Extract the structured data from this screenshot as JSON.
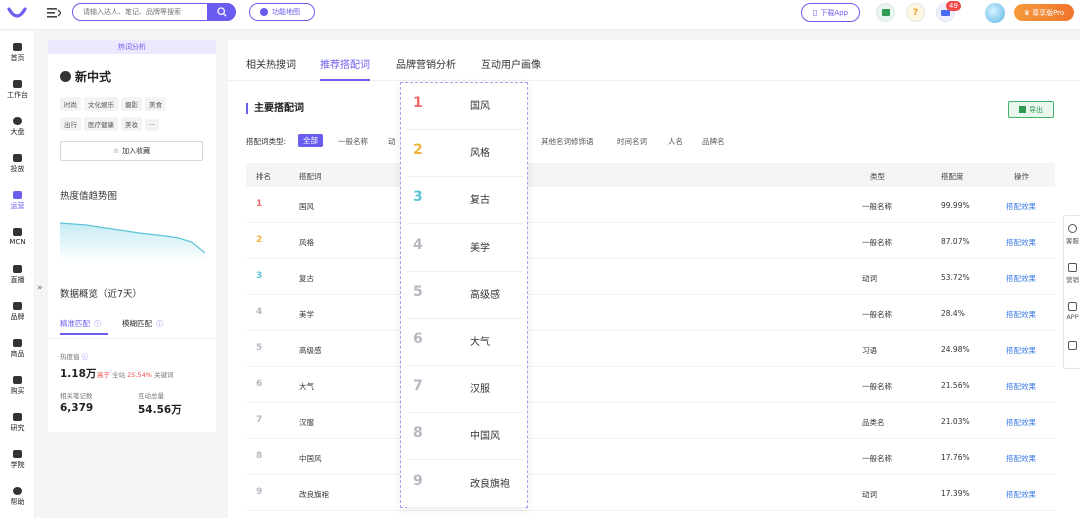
{
  "topbar": {
    "search_placeholder": "请输入达人、笔记、品牌等搜索",
    "feature_map_label": "功能地图",
    "download_app_label": "下载App",
    "notification_count": "49",
    "pro_label": "尊享版Pro"
  },
  "leftnav": {
    "items": [
      {
        "label": "首页",
        "icon": "home-icon"
      },
      {
        "label": "工作台",
        "icon": "workbench-icon"
      },
      {
        "label": "大盘",
        "icon": "pie-icon"
      },
      {
        "label": "投放",
        "icon": "folder-icon"
      },
      {
        "label": "运营",
        "icon": "chart-icon"
      },
      {
        "label": "MCN",
        "icon": "mcn-icon"
      },
      {
        "label": "直播",
        "icon": "video-icon"
      },
      {
        "label": "品牌",
        "icon": "bag-icon"
      },
      {
        "label": "商品",
        "icon": "shop-icon"
      },
      {
        "label": "购买",
        "icon": "cart-icon"
      },
      {
        "label": "研究",
        "icon": "research-icon"
      },
      {
        "label": "学院",
        "icon": "academy-icon"
      },
      {
        "label": "帮助",
        "icon": "help-icon"
      }
    ],
    "active_index": 4
  },
  "leftpanel": {
    "hot_tag": "热词分析",
    "keyword": "新中式",
    "tags": [
      "时尚",
      "文化娱乐",
      "摄影",
      "美食",
      "出行",
      "医疗健康",
      "美妆",
      "···"
    ],
    "fav_label": "加入收藏",
    "trend_title": "热度值趋势图",
    "trend_values": [
      0.78,
      0.76,
      0.74,
      0.7,
      0.66,
      0.62,
      0.58,
      0.55,
      0.52,
      0.48,
      0.4,
      0.18
    ],
    "overview_title": "数据概览（近7天）",
    "match_tabs": [
      "精准匹配",
      "模糊匹配"
    ],
    "metrics": {
      "heat_label": "热度值",
      "heat_value": "1.18万",
      "heat_note_prefix": "高于",
      "heat_note_mid": "全站",
      "heat_note_pct": "25.54%",
      "heat_note_suffix": "关键词",
      "notes_label": "相关笔记数",
      "notes_value": "6,379",
      "interact_label": "互动总量",
      "interact_value": "54.56万"
    }
  },
  "main": {
    "tabs": [
      "相关热搜词",
      "推荐搭配词",
      "品牌营销分析",
      "互动用户画像"
    ],
    "active_tab": 1,
    "section_title": "主要搭配词",
    "export_label": "导出",
    "filter_label": "搭配词类型:",
    "filters": [
      "全部",
      "一般名称",
      "动",
      "其他名词修饰语",
      "时间名词",
      "人名",
      "品牌名"
    ],
    "columns": [
      "排名",
      "搭配词",
      "类型",
      "搭配度",
      "操作"
    ],
    "rows": [
      {
        "rank": "1",
        "word": "国风",
        "type": "一般名称",
        "score": "99.99%",
        "action": "搭配效果"
      },
      {
        "rank": "2",
        "word": "风格",
        "type": "一般名称",
        "score": "87.07%",
        "action": "搭配效果"
      },
      {
        "rank": "3",
        "word": "复古",
        "type": "动词",
        "score": "53.72%",
        "action": "搭配效果"
      },
      {
        "rank": "4",
        "word": "美学",
        "type": "一般名称",
        "score": "28.4%",
        "action": "搭配效果"
      },
      {
        "rank": "5",
        "word": "高级感",
        "type": "习语",
        "score": "24.98%",
        "action": "搭配效果"
      },
      {
        "rank": "6",
        "word": "大气",
        "type": "一般名称",
        "score": "21.56%",
        "action": "搭配效果"
      },
      {
        "rank": "7",
        "word": "汉服",
        "type": "品类名",
        "score": "21.03%",
        "action": "搭配效果"
      },
      {
        "rank": "8",
        "word": "中国风",
        "type": "一般名称",
        "score": "17.76%",
        "action": "搭配效果"
      },
      {
        "rank": "9",
        "word": "改良旗袍",
        "type": "动词",
        "score": "17.39%",
        "action": "搭配效果"
      }
    ]
  },
  "popup": {
    "items": [
      {
        "rank": "1",
        "word": "国风"
      },
      {
        "rank": "2",
        "word": "风格"
      },
      {
        "rank": "3",
        "word": "复古"
      },
      {
        "rank": "4",
        "word": "美学"
      },
      {
        "rank": "5",
        "word": "高级感"
      },
      {
        "rank": "6",
        "word": "大气"
      },
      {
        "rank": "7",
        "word": "汉服"
      },
      {
        "rank": "8",
        "word": "中国风"
      },
      {
        "rank": "9",
        "word": "改良旗袍"
      }
    ]
  },
  "right_tools": {
    "items": [
      {
        "label": "客服",
        "icon": "headset-icon"
      },
      {
        "label": "营销",
        "icon": "monitor-icon"
      },
      {
        "label": "APP",
        "icon": "phone-icon"
      },
      {
        "label": "",
        "icon": "back-to-top-icon"
      }
    ]
  },
  "colors": {
    "accent": "#6b5cf0",
    "rank1": "#f06a6a",
    "rank2": "#f0b43a",
    "rank3": "#5cc4d4",
    "rank_other": "#b5b8c0",
    "link": "#3b7be8"
  }
}
